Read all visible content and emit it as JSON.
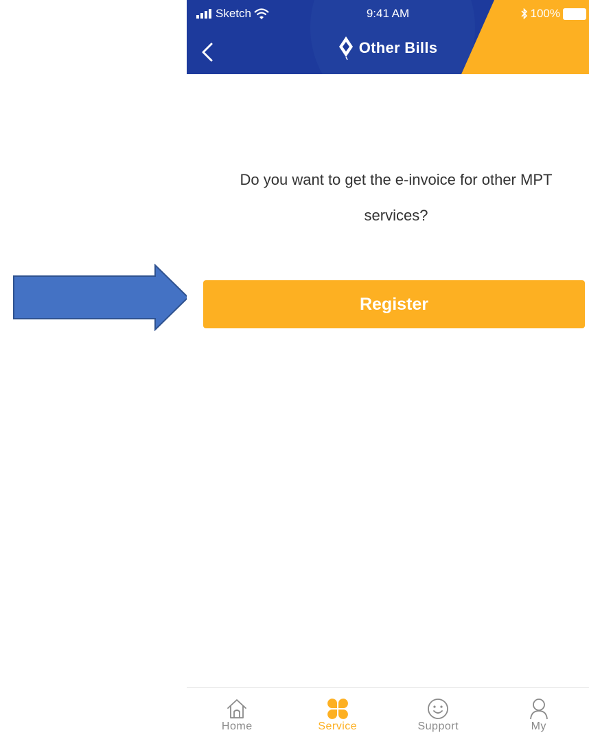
{
  "status_bar": {
    "carrier": "Sketch",
    "time": "9:41 AM",
    "battery": "100%"
  },
  "header": {
    "title": "Other Bills"
  },
  "main": {
    "question": "Do you want to get the e-invoice for other MPT services?"
  },
  "actions": {
    "register_label": "Register"
  },
  "tabbar": {
    "tabs": [
      {
        "label": "Home",
        "icon": "home-icon",
        "active": false
      },
      {
        "label": "Service",
        "icon": "clover-icon",
        "active": true
      },
      {
        "label": "Support",
        "icon": "smiley-icon",
        "active": false
      },
      {
        "label": "My",
        "icon": "user-icon",
        "active": false
      }
    ]
  },
  "colors": {
    "header_blue": "#1d3a9c",
    "accent": "#fdb022",
    "annotation_arrow": "#4472c4"
  }
}
